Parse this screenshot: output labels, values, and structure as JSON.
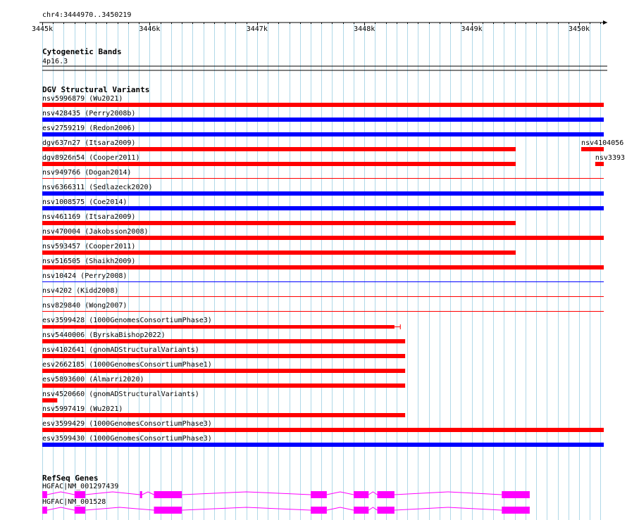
{
  "region": {
    "label": "chr4:3444970..3450219",
    "start": 3444970,
    "end": 3450219
  },
  "ruler": {
    "ticks": [
      {
        "label": "3445k",
        "pos": 3445000
      },
      {
        "label": "3446k",
        "pos": 3446000
      },
      {
        "label": "3447k",
        "pos": 3447000
      },
      {
        "label": "3448k",
        "pos": 3448000
      },
      {
        "label": "3449k",
        "pos": 3449000
      },
      {
        "label": "3450k",
        "pos": 3450000
      }
    ]
  },
  "colors": {
    "gain": "#ff0000",
    "loss": "#0000ff",
    "gene": "#ff00ff",
    "grid": "#b0d8e8"
  },
  "tracks": {
    "cytoband": {
      "title": "Cytogenetic Bands",
      "band": "4p16.3"
    },
    "dgv": {
      "title": "DGV Structural Variants",
      "features": [
        {
          "name": "nsv5996879 (Wu2021)",
          "start": 3445000,
          "end": 3450230,
          "color": "red",
          "style": "thick"
        },
        {
          "name": "nsv428435 (Perry2008b)",
          "start": 3445000,
          "end": 3450230,
          "color": "blue",
          "style": "thick"
        },
        {
          "name": "esv2759219 (Redon2006)",
          "start": 3445000,
          "end": 3450230,
          "color": "blue",
          "style": "thick"
        },
        {
          "name": "dgv637n27 (Itsara2009)",
          "start": 3445000,
          "end": 3449410,
          "color": "red",
          "style": "thick"
        },
        {
          "name": "dgv8926n54 (Cooper2011)",
          "start": 3445000,
          "end": 3449410,
          "color": "red",
          "style": "thick"
        },
        {
          "name": "nsv949766 (Dogan2014)",
          "start": 3445000,
          "end": 3450230,
          "color": "red",
          "style": "thin"
        },
        {
          "name": "nsv6366311 (Sedlazeck2020)",
          "start": 3445000,
          "end": 3450230,
          "color": "blue",
          "style": "thick"
        },
        {
          "name": "nsv1008575 (Coe2014)",
          "start": 3445000,
          "end": 3450230,
          "color": "blue",
          "style": "thick"
        },
        {
          "name": "nsv461169 (Itsara2009)",
          "start": 3445000,
          "end": 3449410,
          "color": "red",
          "style": "thick"
        },
        {
          "name": "nsv470004 (Jakobsson2008)",
          "start": 3445000,
          "end": 3450230,
          "color": "red",
          "style": "thick"
        },
        {
          "name": "nsv593457 (Cooper2011)",
          "start": 3445000,
          "end": 3449410,
          "color": "red",
          "style": "thick"
        },
        {
          "name": "nsv516505 (Shaikh2009)",
          "start": 3445000,
          "end": 3450230,
          "color": "red",
          "style": "thick"
        },
        {
          "name": "nsv10424 (Perry2008)",
          "start": 3445000,
          "end": 3450230,
          "color": "blue",
          "style": "thin"
        },
        {
          "name": "nsv4202 (Kidd2008)",
          "start": 3445000,
          "end": 3450230,
          "color": "red",
          "style": "thin"
        },
        {
          "name": "nsv829840 (Wong2007)",
          "start": 3445000,
          "end": 3450230,
          "color": "red",
          "style": "thin"
        },
        {
          "name": "esv3599428 (1000GenomesConsortiumPhase3)",
          "start": 3445000,
          "end": 3448280,
          "color": "red",
          "style": "medium",
          "endcap": 3448335
        },
        {
          "name": "nsv5440006 (ByrskaBishop2022)",
          "start": 3445000,
          "end": 3448380,
          "color": "red",
          "style": "thick"
        },
        {
          "name": "nsv4102641 (gnomADStructuralVariants)",
          "start": 3445000,
          "end": 3448380,
          "color": "red",
          "style": "thick"
        },
        {
          "name": "esv2662185 (1000GenomesConsortiumPhase1)",
          "start": 3445000,
          "end": 3448380,
          "color": "red",
          "style": "thick"
        },
        {
          "name": "esv5893600 (Almarri2020)",
          "start": 3445000,
          "end": 3448380,
          "color": "red",
          "style": "thick"
        },
        {
          "name": "nsv4520660 (gnomADStructuralVariants)",
          "start": 3445000,
          "end": 3445140,
          "color": "red",
          "style": "thick"
        },
        {
          "name": "nsv5997419 (Wu2021)",
          "start": 3445000,
          "end": 3448380,
          "color": "red",
          "style": "thick"
        },
        {
          "name": "esv3599429 (1000GenomesConsortiumPhase3)",
          "start": 3445000,
          "end": 3450230,
          "color": "red",
          "style": "thick"
        },
        {
          "name": "esv3599430 (1000GenomesConsortiumPhase3)",
          "start": 3445000,
          "end": 3450230,
          "color": "blue",
          "style": "thick"
        }
      ],
      "side_features": [
        {
          "name": "nsv4104056",
          "start": 3450020,
          "end": 3450230,
          "color": "red",
          "row": 3
        },
        {
          "name": "nsv3393",
          "start": 3450150,
          "end": 3450230,
          "color": "red",
          "row": 4
        }
      ]
    },
    "refseq": {
      "title": "RefSeq Genes",
      "genes": [
        {
          "name": "HGFAC|NM_001297439",
          "start": 3445000,
          "end": 3448480,
          "exons": [
            {
              "start": 3445000,
              "end": 3445045
            },
            {
              "start": 3445300,
              "end": 3445400
            },
            {
              "start": 3445910,
              "end": 3445930
            },
            {
              "start": 3446040,
              "end": 3446300
            },
            {
              "start": 3447500,
              "end": 3447650
            },
            {
              "start": 3447900,
              "end": 3448040
            },
            {
              "start": 3448120,
              "end": 3448280
            },
            {
              "start": 3449280,
              "end": 3449540
            }
          ]
        },
        {
          "name": "HGFAC|NM_001528",
          "start": 3445000,
          "end": 3449540,
          "exons": [
            {
              "start": 3445000,
              "end": 3445045
            },
            {
              "start": 3445300,
              "end": 3445400
            },
            {
              "start": 3446040,
              "end": 3446300
            },
            {
              "start": 3447500,
              "end": 3447650
            },
            {
              "start": 3447900,
              "end": 3448040
            },
            {
              "start": 3448120,
              "end": 3448280
            },
            {
              "start": 3449280,
              "end": 3449540
            }
          ]
        }
      ]
    }
  }
}
